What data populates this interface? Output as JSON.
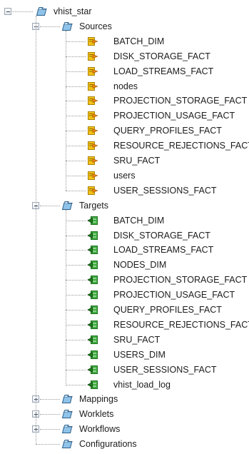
{
  "tree": {
    "root": {
      "label": "vhist_star",
      "icon": "folder-icon",
      "expanded": true
    },
    "sources": {
      "label": "Sources",
      "icon": "folder-icon",
      "expanded": true,
      "item_icon": "source-icon",
      "items": [
        "BATCH_DIM",
        "DISK_STORAGE_FACT",
        "LOAD_STREAMS_FACT",
        "nodes",
        "PROJECTION_STORAGE_FACT",
        "PROJECTION_USAGE_FACT",
        "QUERY_PROFILES_FACT",
        "RESOURCE_REJECTIONS_FACT",
        "SRU_FACT",
        "users",
        "USER_SESSIONS_FACT"
      ]
    },
    "targets": {
      "label": "Targets",
      "icon": "folder-icon",
      "expanded": true,
      "item_icon": "target-icon",
      "items": [
        "BATCH_DIM",
        "DISK_STORAGE_FACT",
        "LOAD_STREAMS_FACT",
        "NODES_DIM",
        "PROJECTION_STORAGE_FACT",
        "PROJECTION_USAGE_FACT",
        "QUERY_PROFILES_FACT",
        "RESOURCE_REJECTIONS_FACT",
        "SRU_FACT",
        "USERS_DIM",
        "USER_SESSIONS_FACT",
        "vhist_load_log"
      ]
    },
    "collapsed_folders": [
      {
        "label": "Mappings",
        "expandable": true
      },
      {
        "label": "Worklets",
        "expandable": true
      },
      {
        "label": "Workflows",
        "expandable": true
      },
      {
        "label": "Configurations",
        "expandable": false
      }
    ]
  },
  "colors": {
    "folder_fill": "#8fc4ea",
    "folder_stroke": "#2d5f8a",
    "source_yellow": "#f3c316",
    "target_green": "#3fae3f",
    "connector": "#9a9a9a"
  }
}
